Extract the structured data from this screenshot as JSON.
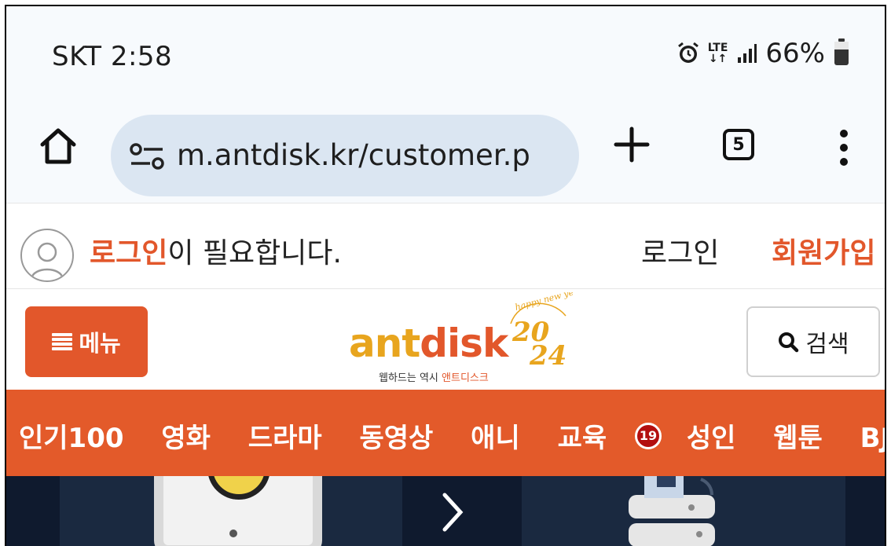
{
  "status_bar": {
    "carrier_time": "SKT 2:58",
    "network": "LTE",
    "battery": "66%",
    "icons": [
      "alarm-icon",
      "lte-icon",
      "signal-icon",
      "battery-icon"
    ]
  },
  "browser": {
    "url": "m.antdisk.kr/customer.p",
    "tab_count": "5",
    "icons": [
      "home-icon",
      "site-settings-icon",
      "new-tab-icon",
      "tab-switcher-icon",
      "more-icon"
    ]
  },
  "login_bar": {
    "message_highlight": "로그인",
    "message_rest": "이 필요합니다.",
    "login_label": "로그인",
    "join_label": "회원가입"
  },
  "header": {
    "menu_label": "메뉴",
    "logo_ant": "ant",
    "logo_disk": "disk",
    "logo_tagline_prefix": "웹하드는 역시 ",
    "logo_tagline_brand": "앤트디스크",
    "logo_year": "2024",
    "logo_greeting": "happy new year",
    "search_label": "검색"
  },
  "nav": {
    "items": [
      "인기100",
      "영화",
      "드라마",
      "동영상",
      "애니",
      "교육",
      "성인",
      "웹툰",
      "BJ방"
    ],
    "adult_badge": "19"
  },
  "colors": {
    "accent": "#e2572b",
    "logo_gold": "#e8a51e",
    "url_pill": "#dbe6f2",
    "banner_bg": "#0f1a2e"
  }
}
